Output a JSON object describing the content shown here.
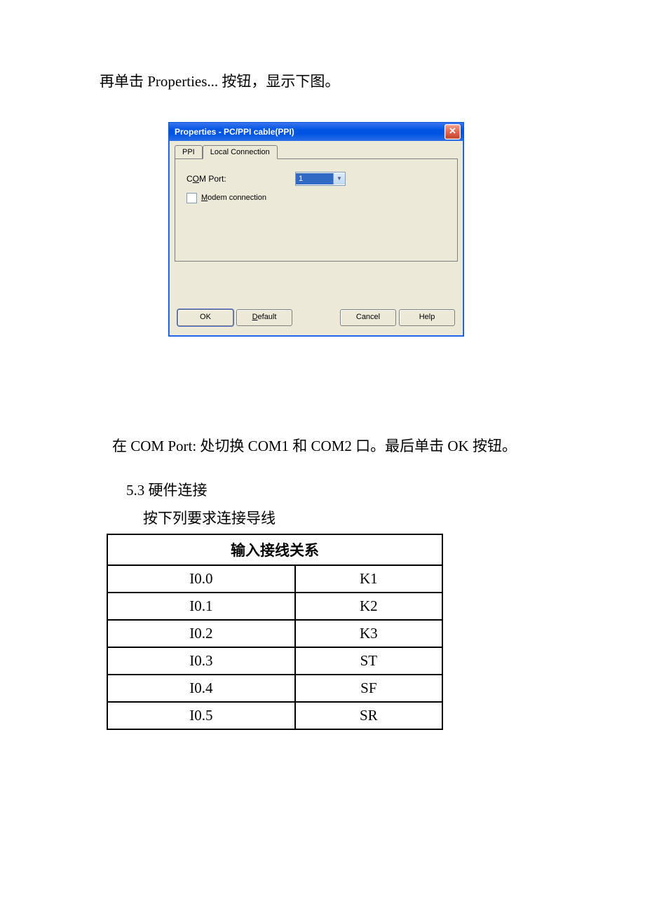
{
  "text": {
    "intro": "再单击 Properties... 按钮，显示下图。",
    "after_dialog": "在 COM Port: 处切换 COM1 和 COM2 口。最后单击 OK 按钮。",
    "section": "5.3 硬件连接",
    "instruction": "按下列要求连接导线"
  },
  "dialog": {
    "title": "Properties - PC/PPI cable(PPI)",
    "tabs": {
      "ppi": "PPI",
      "local": "Local Connection"
    },
    "fields": {
      "com_port_label_prefix": "C",
      "com_port_label_u": "O",
      "com_port_label_suffix": "M Port:",
      "com_port_value": "1",
      "modem_u": "M",
      "modem_rest": "odem connection"
    },
    "buttons": {
      "ok": "OK",
      "default_u": "D",
      "default_rest": "efault",
      "cancel": "Cancel",
      "help": "Help"
    }
  },
  "table": {
    "header": "输入接线关系",
    "rows": [
      {
        "io": "I0.0",
        "k": "K1"
      },
      {
        "io": "I0.1",
        "k": "K2"
      },
      {
        "io": "I0.2",
        "k": "K3"
      },
      {
        "io": "I0.3",
        "k": "ST"
      },
      {
        "io": "I0.4",
        "k": "SF"
      },
      {
        "io": "I0.5",
        "k": "SR"
      }
    ]
  }
}
